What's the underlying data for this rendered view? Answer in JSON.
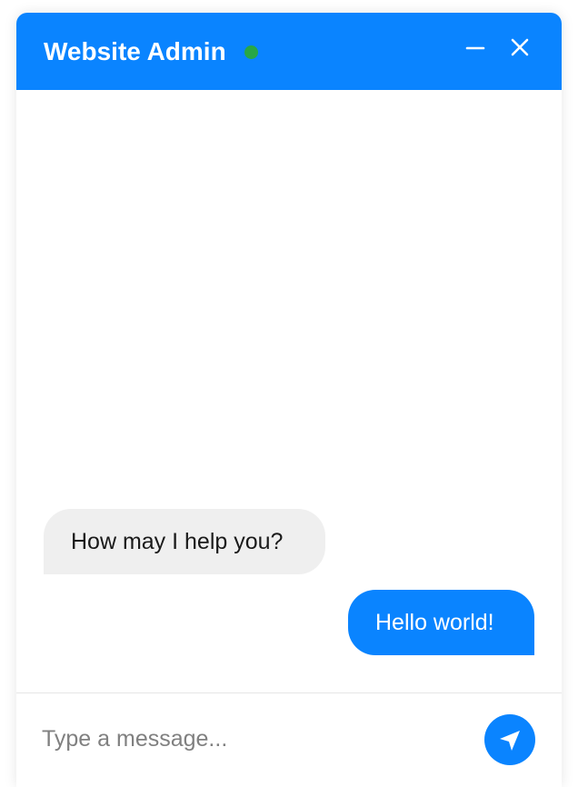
{
  "header": {
    "title": "Website Admin",
    "status": "online",
    "status_color": "#28a745",
    "background_color": "#0a84ff",
    "minimize_icon": "minimize-icon",
    "close_icon": "close-icon"
  },
  "messages": [
    {
      "sender": "admin",
      "text": "How may I help you?"
    },
    {
      "sender": "user",
      "text": "Hello world!"
    }
  ],
  "composer": {
    "placeholder": "Type a message...",
    "value": "",
    "send_icon": "send-icon"
  },
  "colors": {
    "accent": "#0a84ff",
    "incoming_bubble": "#efefef",
    "outgoing_bubble": "#0a84ff"
  }
}
